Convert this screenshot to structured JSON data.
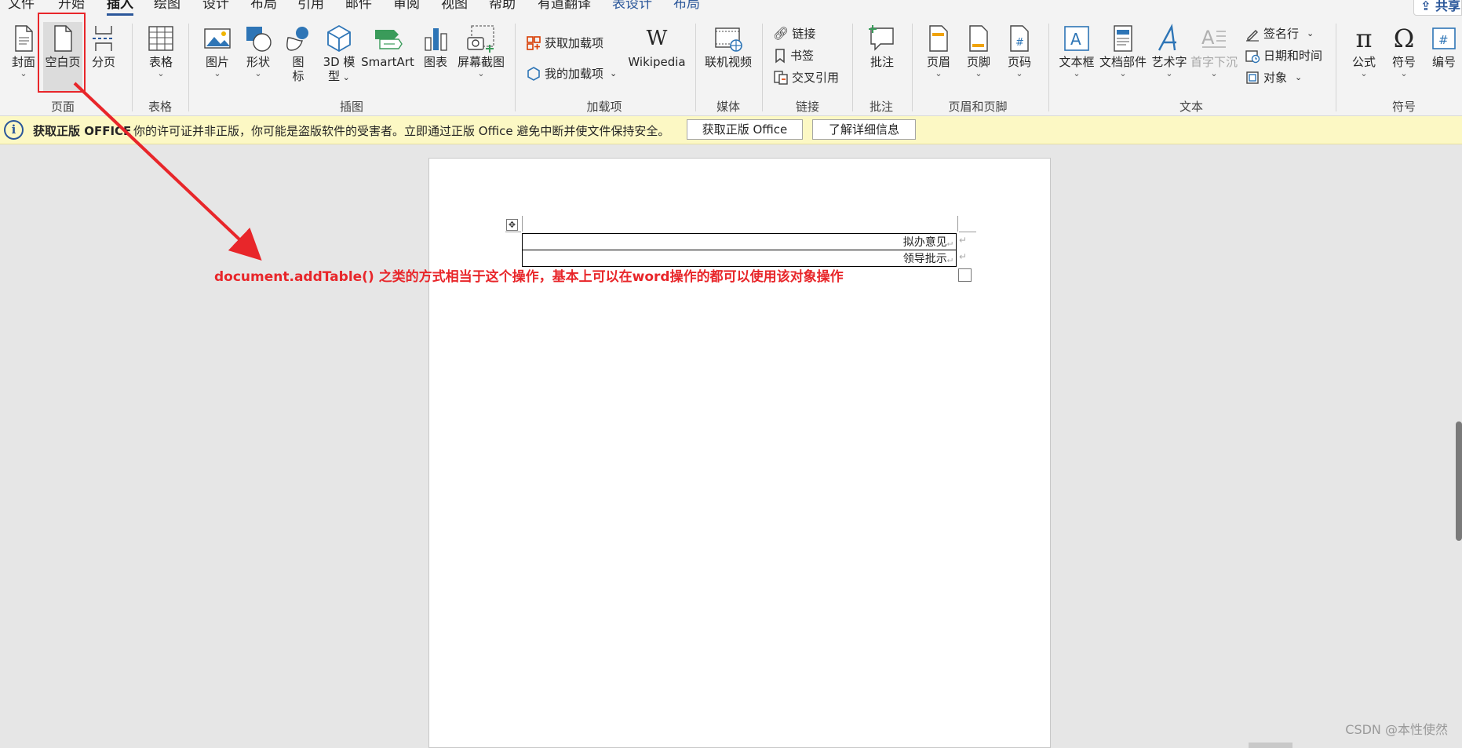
{
  "tabs": {
    "file": "文件",
    "home": "开始",
    "insert": "插入",
    "draw": "绘图",
    "design": "设计",
    "layout": "布局",
    "references": "引用",
    "mailings": "邮件",
    "review": "审阅",
    "view": "视图",
    "help": "帮助",
    "youdao": "有道翻译",
    "table_design": "表设计",
    "table_layout": "布局",
    "share": "共享"
  },
  "ribbon": {
    "pages": {
      "cover": "封面",
      "blank_page": "空白页",
      "page_break": "分页",
      "group_label": "页面"
    },
    "tables": {
      "table": "表格",
      "group_label": "表格"
    },
    "illustrations": {
      "pictures": "图片",
      "shapes": "形状",
      "icons_line1": "图",
      "icons_line2": "标",
      "model3d_line1": "3D 模",
      "model3d_line2": "型",
      "smartart": "SmartArt",
      "chart": "图表",
      "screenshot": "屏幕截图",
      "group_label": "插图"
    },
    "addins": {
      "get_addins": "获取加载项",
      "my_addins": "我的加载项",
      "wikipedia": "Wikipedia",
      "wikipedia_icon": "W",
      "group_label": "加载项"
    },
    "media": {
      "online_video": "联机视频",
      "group_label": "媒体"
    },
    "links": {
      "link": "链接",
      "bookmark": "书签",
      "cross_ref": "交叉引用",
      "group_label": "链接"
    },
    "comments": {
      "comment": "批注",
      "group_label": "批注"
    },
    "header_footer": {
      "header": "页眉",
      "footer": "页脚",
      "page_number": "页码",
      "group_label": "页眉和页脚"
    },
    "text": {
      "textbox": "文本框",
      "quick_parts": "文档部件",
      "wordart": "艺术字",
      "dropcap": "首字下沉",
      "signature_line": "签名行",
      "date_time": "日期和时间",
      "object": "对象",
      "group_label": "文本"
    },
    "symbols": {
      "equation": "公式",
      "symbol": "符号",
      "numbering": "编号",
      "group_label": "符号"
    }
  },
  "infobar": {
    "title": "获取正版 OFFICE",
    "message": "你的许可证并非正版，你可能是盗版软件的受害者。立即通过正版 Office 避免中断并使文件保持安全。",
    "get_button": "获取正版 Office",
    "learn_button": "了解详细信息"
  },
  "document": {
    "rows": [
      "拟办意见",
      "领导批示"
    ],
    "paragraph_mark": "↵"
  },
  "annotation_text": "document.addTable() 之类的方式相当于这个操作，基本上可以在word操作的都可以使用该对象操作",
  "watermark": "CSDN @本性使然",
  "colors": {
    "accent": "#2b579a",
    "annotation": "#e8262a",
    "infobar_bg": "#fcf8c4"
  }
}
